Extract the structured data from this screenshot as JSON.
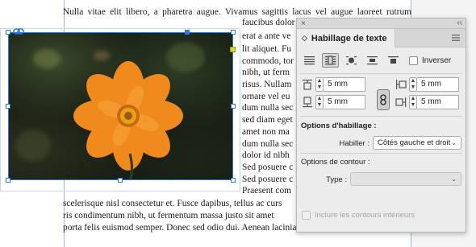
{
  "document": {
    "lines_top": [
      "Nulla vitae elit libero, a pharetra augue. Vivamus sagittis lacus vel augue laoreet rutrum"
    ],
    "lines_right": [
      "faucibus dolor",
      "erat a ante ve",
      "lit aliquet. Fu",
      "commodo, tor",
      "nibh, ut ferm",
      "risus. Nullam",
      "ornare vel eu",
      "dum nulla sec",
      "sed diam eget",
      "amet non ma",
      "dum nulla sec",
      "dolor id nibh",
      "Sed posuere c",
      "Sed posuere c",
      "Praesent com"
    ],
    "lines_bottom": [
      "scelerisque nisl consectetur et. Fusce dapibus, tellus ac curs",
      "ris condimentum nibh, ut fermentum massa justo sit amet",
      "porta felis euismod semper. Donec sed odio dui. Aenean lacinia bibendum nulla sed"
    ]
  },
  "icons": {
    "image_link": "link-icon",
    "photo_subject": "orange-cosmos-flower"
  },
  "panel": {
    "close_glyph": "×",
    "collapse_glyph": "‹‹",
    "tab_title": "Habillage de texte",
    "tab_chevron": "◇",
    "wrap_modes": [
      {
        "name": "no-wrap",
        "icon": "wrap-none-icon",
        "active": false
      },
      {
        "name": "bounding-box",
        "icon": "wrap-bounding-box-icon",
        "active": true
      },
      {
        "name": "object-shape",
        "icon": "wrap-object-shape-icon",
        "active": false
      },
      {
        "name": "jump-object",
        "icon": "wrap-jump-object-icon",
        "active": false
      },
      {
        "name": "jump-next-column",
        "icon": "wrap-next-column-icon",
        "active": false
      }
    ],
    "invert_label": "Inverser",
    "offsets": {
      "top": "5 mm",
      "bottom": "5 mm",
      "left": "5 mm",
      "right": "5 mm"
    },
    "options_title": "Options d'habillage :",
    "wrap_label": "Habiller :",
    "wrap_value": "Côtés gauche et droit",
    "contour_title": "Options de contour :",
    "type_label": "Type :",
    "type_value": "",
    "include_inner_label": "Inclure les contours intérieurs"
  },
  "colors": {
    "selection": "#2b78e4",
    "panel_bg": "#ececec",
    "flower": "#f08a1c"
  }
}
